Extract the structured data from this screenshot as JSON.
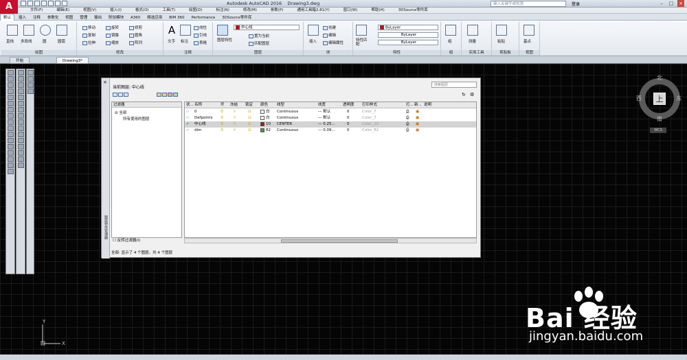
{
  "app": {
    "title": "Autodesk AutoCAD 2016",
    "document": "Drawing3.dwg",
    "search_placeholder": "键入关键字或短语",
    "login": "登录"
  },
  "menu": [
    "文件(F)",
    "编辑(E)",
    "视图(V)",
    "插入(I)",
    "格式(O)",
    "工具(T)",
    "绘图(D)",
    "标注(N)",
    "修改(M)",
    "参数(P)",
    "通用工具箱2.81(Y)",
    "窗口(W)",
    "帮助(H)",
    "3DSource零件库"
  ],
  "ribbon_tabs": [
    "默认",
    "插入",
    "注释",
    "参数化",
    "视图",
    "管理",
    "输出",
    "附加模块",
    "A360",
    "精选应用",
    "BIM 360",
    "Performance",
    "3DSource零件库"
  ],
  "ribbon": {
    "panels": [
      "绘图",
      "修改",
      "注释",
      "图层",
      "块",
      "特性",
      "组",
      "实用工具",
      "剪贴板",
      "视图"
    ],
    "draw_tools": [
      "直线",
      "多段线",
      "圆",
      "圆弧"
    ],
    "modify_tools": [
      "移动",
      "旋转",
      "修剪",
      "复制",
      "镜像",
      "圆角",
      "拉伸",
      "缩放",
      "阵列"
    ],
    "annot_tools": [
      "文字",
      "标注",
      "线性",
      "引线",
      "表格"
    ],
    "layer_tools": [
      "图层特性",
      "置为当前",
      "匹配图层"
    ],
    "layer_current": "中心线",
    "block_tools": [
      "插入",
      "创建",
      "编辑",
      "编辑属性"
    ],
    "prop_tools": [
      "特性匹配"
    ],
    "bylayer": [
      "ByLayer",
      "ByLayer",
      "ByLayer"
    ],
    "group": "组",
    "util": "测量",
    "clip": "粘贴",
    "base": "基点"
  },
  "doc_tabs": [
    "开始",
    "Drawing3*"
  ],
  "compass": {
    "n": "北",
    "s": "南",
    "e": "东",
    "w": "西",
    "top": "上",
    "wcs": "WCS"
  },
  "layer_manager": {
    "current_label": "当前图层: 中心线",
    "search_placeholder": "搜索图层",
    "side_title": "图层特性管理器",
    "filter_header": "过滤器",
    "filter_all": "全部",
    "filter_used": "所有使用的图层",
    "invert_filter": "反转过滤器(I)",
    "status": "全部: 显示了 4 个图层，共 4 个图层",
    "columns": [
      "状...",
      "名称",
      "开",
      "冻结",
      "锁定",
      "颜色",
      "线型",
      "线宽",
      "透明度",
      "打印样式",
      "打...",
      "新...",
      "说明"
    ],
    "rows": [
      {
        "name": "0",
        "color": "白",
        "color_hex": "#ffffff",
        "linetype": "Continuous",
        "lineweight": "— 默认",
        "transp": "0",
        "plot": "Color_7"
      },
      {
        "name": "Defpoints",
        "color": "白",
        "color_hex": "#ffffff",
        "linetype": "Continuous",
        "lineweight": "— 默认",
        "transp": "0",
        "plot": "Color_7"
      },
      {
        "name": "中心线",
        "color": "10",
        "color_hex": "#d40000",
        "linetype": "CENTER",
        "lineweight": "— 0.25...",
        "transp": "0",
        "plot": "Color_10"
      },
      {
        "name": "dim",
        "color": "82",
        "color_hex": "#3aa03a",
        "linetype": "Continuous",
        "lineweight": "— 0.09...",
        "transp": "0",
        "plot": "Color_82"
      }
    ]
  },
  "watermark": {
    "text": "Bai 经验",
    "url": "jingyan.baidu.com"
  }
}
